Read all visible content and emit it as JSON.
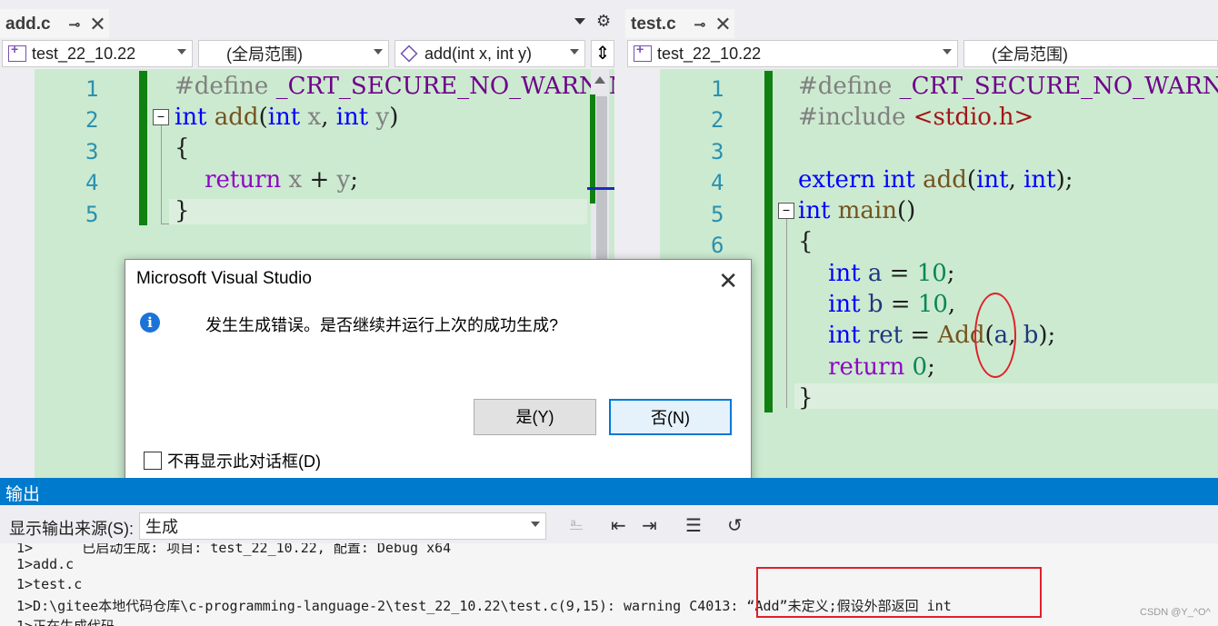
{
  "left_tab": {
    "title": "add.c",
    "pin": "⊸",
    "close": "✕"
  },
  "right_tab": {
    "title": "test.c",
    "pin": "⊸",
    "close": "✕"
  },
  "left_nav": {
    "project": "test_22_10.22",
    "scope": "(全局范围)",
    "member": "add(int x, int y)"
  },
  "right_nav": {
    "project": "test_22_10.22",
    "scope": "(全局范围)"
  },
  "left_editor": {
    "line_numbers": [
      "1",
      "2",
      "3",
      "4",
      "5"
    ]
  },
  "right_editor": {
    "line_numbers": [
      "1",
      "2",
      "3",
      "4",
      "5",
      "6"
    ]
  },
  "dialog": {
    "title": "Microsoft Visual Studio",
    "message": "发生生成错误。是否继续并运行上次的成功生成?",
    "yes_label": "是(Y)",
    "no_label": "否(N)",
    "checkbox_label": "不再显示此对话框(D)",
    "info_icon": "i"
  },
  "output": {
    "title": "输出",
    "source_label": "显示输出来源(S):",
    "source_value": "生成",
    "lines": [
      "1>      已启动生成: 项目: test_22_10.22, 配置: Debug x64",
      "1>add.c",
      "1>test.c",
      "1>D:\\gitee本地代码仓库\\c-programming-language-2\\test_22_10.22\\test.c(9,15): warning C4013: “Add”未定义;假设外部返回 int",
      "1>正在生成代码..."
    ]
  },
  "watermark": "CSDN @Y_^O^",
  "colors": {
    "accent": "#007acc",
    "highlight_red": "#e0202a",
    "change_bar": "#108010"
  }
}
